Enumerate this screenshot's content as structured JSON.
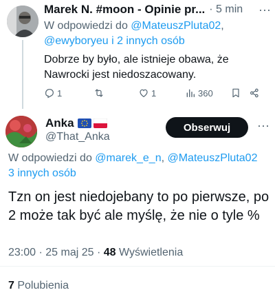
{
  "reply": {
    "author_name": "Marek N. #moon - Opinie pr...",
    "time": "· 5 min",
    "more": "···",
    "replying_prefix": "W odpowiedzi do ",
    "replying_mention1": "@MateuszPluta02",
    "replying_sep": ",",
    "replying_mention2": "@ewyboryeu i 2 innych osób",
    "text": "Dobrze by było, ale istnieje obawa, że Nawrocki jest niedoszacowany.",
    "actions": {
      "reply_icon": "reply-icon",
      "reply_count": "1",
      "retweet_icon": "retweet-icon",
      "like_icon": "heart-icon",
      "like_count": "1",
      "views_icon": "views-icon",
      "views_count": "360",
      "bookmark_icon": "bookmark-icon",
      "share_icon": "share-icon"
    }
  },
  "tweet": {
    "author_name": "Anka",
    "flags": [
      "eu-flag",
      "poland-flag"
    ],
    "handle": "@That_Anka",
    "follow_label": "Obserwuj",
    "more": "···",
    "replying_prefix": "W odpowiedzi do ",
    "replying_mention1": "@marek_e_n",
    "replying_sep": ", ",
    "replying_mention2": "@MateuszPluta02",
    "replying_line2": "3 innych osób",
    "text": "Tzn on jest niedojebany to po pierwsze, po 2 może tak być ale myślę, że nie o tyle %",
    "time": "23:00 · 25 maj 25 · ",
    "views_count": "48",
    "views_label": " Wyświetlenia",
    "likes_count": "7",
    "likes_label": " Polubienia"
  },
  "colors": {
    "accent": "#1d9bf0",
    "text": "#0f1419",
    "secondary": "#536471",
    "button_bg": "#0f1419"
  }
}
